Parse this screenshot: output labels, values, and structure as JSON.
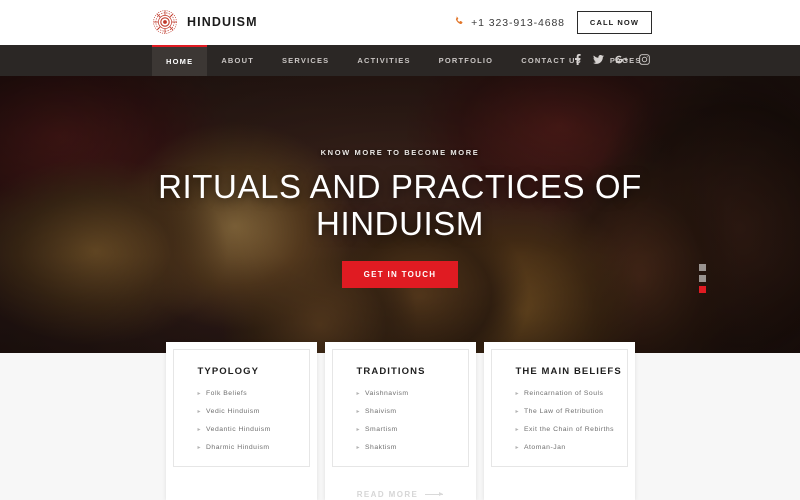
{
  "header": {
    "logo_icon": "mandala-icon",
    "brand_name": "HINDUISM",
    "phone_icon": "phone-icon",
    "phone_number": "+1 323-913-4688",
    "call_button": "CALL NOW"
  },
  "nav": {
    "items": [
      {
        "label": "HOME",
        "active": true
      },
      {
        "label": "ABOUT",
        "active": false
      },
      {
        "label": "SERVICES",
        "active": false
      },
      {
        "label": "ACTIVITIES",
        "active": false
      },
      {
        "label": "PORTFOLIO",
        "active": false
      },
      {
        "label": "CONTACT US",
        "active": false
      },
      {
        "label": "PAGES",
        "active": false
      }
    ],
    "socials": [
      {
        "icon": "facebook-icon",
        "label": "f"
      },
      {
        "icon": "twitter-icon",
        "label": "t"
      },
      {
        "icon": "google-plus-icon",
        "label": "G+"
      },
      {
        "icon": "instagram-icon",
        "label": "ig"
      }
    ]
  },
  "hero": {
    "eyebrow": "KNOW MORE TO BECOME MORE",
    "title": "RITUALS AND PRACTICES OF HINDUISM",
    "cta_label": "GET IN TOUCH",
    "slider_dots": [
      {
        "active": false
      },
      {
        "active": false
      },
      {
        "active": true
      }
    ]
  },
  "cards": [
    {
      "title": "TYPOLOGY",
      "items": [
        "Folk Beliefs",
        "Vedic Hinduism",
        "Vedantic Hinduism",
        "Dharmic Hinduism"
      ]
    },
    {
      "title": "TRADITIONS",
      "items": [
        "Vaishnavism",
        "Shaivism",
        "Smartism",
        "Shaktism"
      ]
    },
    {
      "title": "THE MAIN BELIEFS",
      "items": [
        "Reincarnation of Souls",
        "The Law of Retribution",
        "Exit the Chain of Rebirths",
        "Atoman-Jan"
      ]
    }
  ],
  "footer_link": {
    "label": "READ MORE"
  },
  "colors": {
    "accent_red": "#e01b22",
    "nav_dark": "#2b2725",
    "phone_orange": "#e2762a"
  }
}
